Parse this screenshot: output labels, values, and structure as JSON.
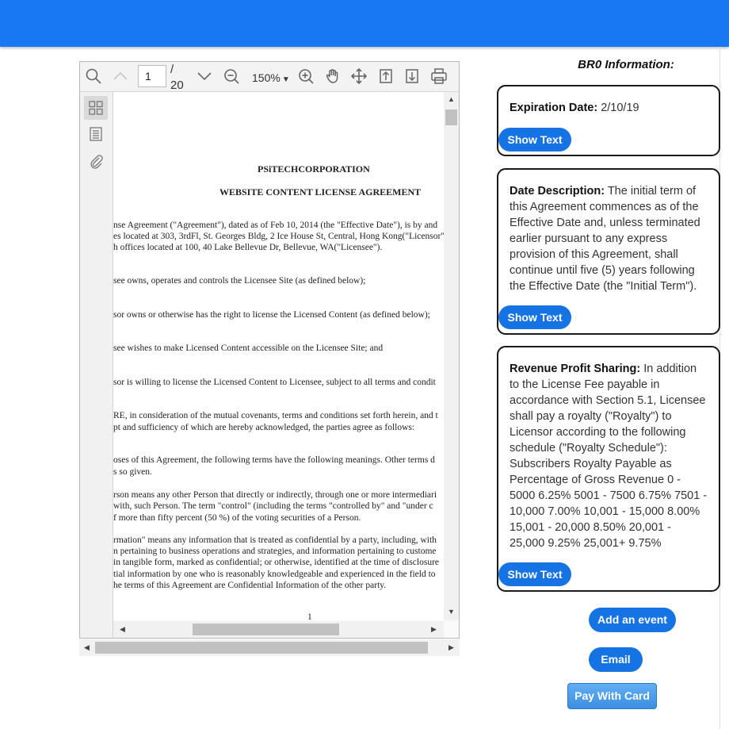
{
  "viewer": {
    "page_current": "1",
    "page_sep": "/",
    "page_total": "20",
    "zoom": "150%",
    "zoom_caret": "▼",
    "document": {
      "company": "PSiTECHCORPORATION",
      "title": "WEBSITE CONTENT LICENSE AGREEMENT",
      "lines": [
        "nse Agreement (\"Agreement\"), dated as of Feb 10, 2014 (the \"Effective Date\"), is by and",
        "es located at 303, 3rdFl, St. Georges Bldg, 2 Ice House St, Central, Hong Kong(\"Licensor\"",
        "h offices located at 100, 40 Lake Bellevue Dr, Bellevue, WA(\"Licensee\").",
        "see owns, operates and controls the Licensee Site (as defined below);",
        "sor owns or otherwise has the right to license the Licensed Content (as defined below);",
        "see wishes to make Licensed Content accessible on the Licensee Site; and",
        "sor is willing to license the Licensed Content to Licensee, subject to all terms and condit",
        "RE, in consideration of the mutual covenants, terms and conditions set forth herein, and t",
        "pt and sufficiency of which are hereby acknowledged, the parties agree as follows:",
        "oses of this Agreement, the following terms have the following meanings. Other terms d",
        "s so given.",
        "rson means any other Person that directly or indirectly, through one or more intermediari",
        "with, such Person. The term \"control\" (including the terms \"controlled by\" and \"under c",
        "f more than fifty percent (50 %) of the voting securities of a Person.",
        "rmation\" means any information that is treated as confidential by a party, including, with",
        "n pertaining to business operations and strategies, and information pertaining to custome",
        "in tangible form, marked as confidential; or otherwise, identified at the time of disclosure",
        "tial information by one who is reasonably knowledgeable and experienced in the field to",
        "he terms of this Agreement are Confidential Information of the other party."
      ],
      "page_number": "1"
    }
  },
  "panel": {
    "title": "BR0 Information:",
    "cards": [
      {
        "label": "Expiration Date:",
        "text": " 2/10/19",
        "button": "Show Text"
      },
      {
        "label": "Date Description:",
        "text": " The initial term of this Agreement commences as of the Effective Date and, unless terminated earlier pursuant to any express provision of this Agreement, shall continue until five (5) years following the Effective Date (the \"Initial Term\").",
        "button": "Show Text"
      },
      {
        "label": "Revenue Profit Sharing:",
        "text": " In addition to the License Fee payable in accordance with Section 5.1, Licensee shall pay a royalty (\"Royalty\") to Licensor according to the following schedule (\"Royalty Schedule\"): Subscribers Royalty Payable as Percentage of Gross Revenue 0 - 5000 6.25% 5001 - 7500 6.75% 7501 - 10,000 7.00% 10,001 - 15,000 8.00% 15,001 - 20,000 8.50% 20,001 - 25,000 9.25% 25,001+ 9.75%",
        "button": "Show Text"
      }
    ],
    "add_event": "Add an event",
    "email": "Email",
    "pay": "Pay With Card"
  },
  "colors": {
    "header": "#1877f2",
    "button": "#1673e4"
  },
  "icons": [
    "search-icon",
    "chevron-up-icon",
    "chevron-down-icon",
    "zoom-out-icon",
    "zoom-in-icon",
    "pan-icon",
    "move-icon",
    "page-up-icon",
    "page-down-icon",
    "print-icon",
    "thumbnails-icon",
    "outline-icon",
    "attachment-icon"
  ]
}
